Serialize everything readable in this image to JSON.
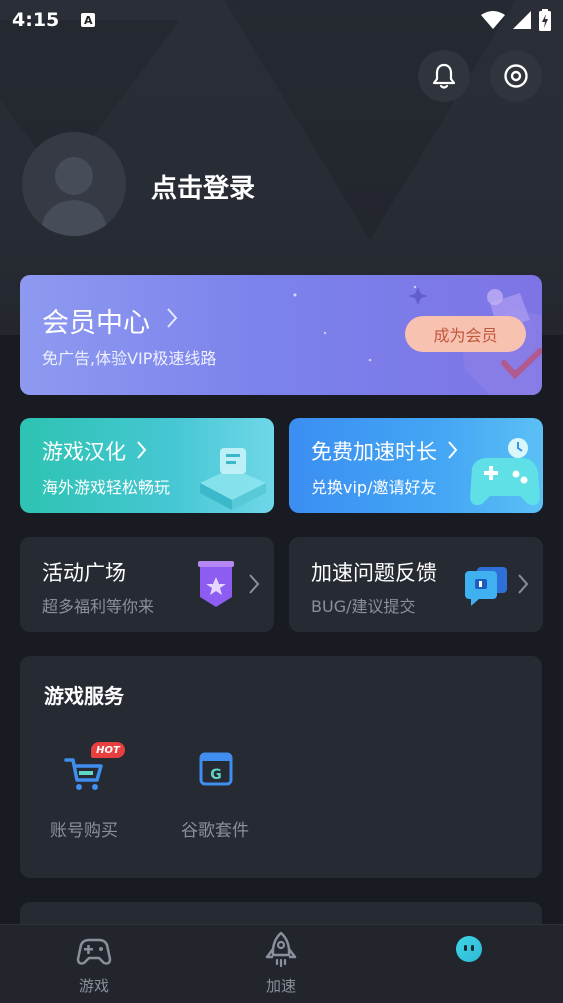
{
  "status": {
    "time": "4:15",
    "notification_letter": "A"
  },
  "header": {
    "notification_icon": "bell-icon",
    "settings_icon": "settings-icon"
  },
  "profile": {
    "login_text": "点击登录"
  },
  "vip": {
    "title": "会员中心",
    "subtitle": "免广告,体验VIP极速线路",
    "button": "成为会员"
  },
  "features": [
    {
      "title": "游戏汉化",
      "subtitle": "海外游戏轻松畅玩"
    },
    {
      "title": "免费加速时长",
      "subtitle": "兑换vip/邀请好友"
    }
  ],
  "activities": [
    {
      "title": "活动广场",
      "subtitle": "超多福利等你来"
    },
    {
      "title": "加速问题反馈",
      "subtitle": "BUG/建议提交"
    }
  ],
  "services": {
    "title": "游戏服务",
    "items": [
      {
        "label": "账号购买",
        "badge": "HOT",
        "icon": "cart-icon"
      },
      {
        "label": "谷歌套件",
        "icon": "google-suite-icon",
        "letter": "G"
      }
    ]
  },
  "tabs": [
    {
      "label": "游戏",
      "icon": "gamepad-icon"
    },
    {
      "label": "加速",
      "icon": "rocket-icon"
    },
    {
      "label": "",
      "icon": "profile-face-icon"
    }
  ],
  "colors": {
    "background": "#181b22",
    "card": "#262a32",
    "vip_gradient": [
      "#8e9af0",
      "#7d74e6"
    ],
    "vip_button": "#f7c2b0",
    "active_tab": "#3fd6e6"
  }
}
